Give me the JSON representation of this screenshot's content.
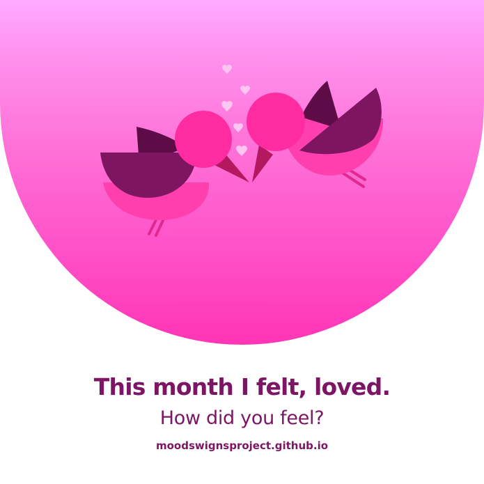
{
  "poster": {
    "headline": "This month I felt, loved.",
    "subline": "How did you feel?",
    "url": "moodswignsproject.github.io"
  },
  "illustration": {
    "subject": "two kissing birds with hearts",
    "icons": [
      "bird-icon",
      "heart-icon"
    ]
  },
  "colors": {
    "gradient_top": "#ffaaff",
    "gradient_bottom": "#ff35b6",
    "bird_body": "#ff3fae",
    "bird_head": "#ff2ba0",
    "wing_dark": "#5e0c47",
    "wing_mid": "#7d1560",
    "beak": "#b4185f",
    "heart": "#ffc6f1",
    "text": "#7c1563"
  }
}
